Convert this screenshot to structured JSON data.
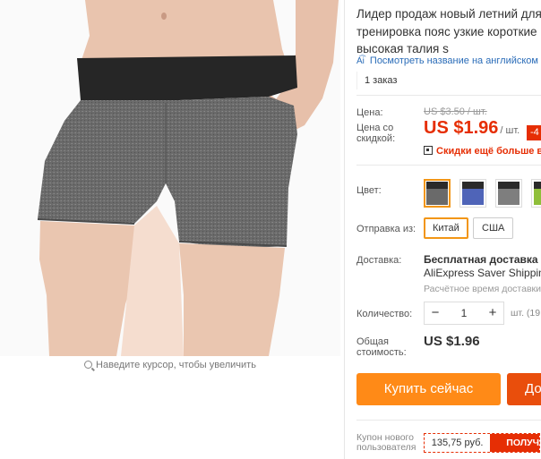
{
  "product_image": {
    "zoom_hint": "Наведите курсор, чтобы увеличить"
  },
  "product": {
    "title_lines": [
      "Лидер продаж новый летний для",
      "тренировка пояс узкие короткие",
      "высокая талия s"
    ],
    "translate_link": "Посмотреть название на английском",
    "translate_icon": "translate-icon",
    "orders": "1 заказ"
  },
  "pricing": {
    "price_label": "Цена:",
    "old_price": "US $3.50 / шт.",
    "discount_price_label_lines": [
      "Цена со",
      "скидкой:"
    ],
    "discount_price": "US $1.96",
    "unit": "/ шт.",
    "discount_badge": "-4",
    "app_discount": "Скидки ещё больше в",
    "accent_color": "#e62e04"
  },
  "options": {
    "color_label": "Цвет:",
    "color_swatches": [
      {
        "name": "grey",
        "selected": true
      },
      {
        "name": "blue",
        "selected": false
      },
      {
        "name": "grey-black",
        "selected": false
      },
      {
        "name": "green",
        "selected": false
      }
    ],
    "ship_from_label": "Отправка из:",
    "ship_from_options": [
      {
        "label": "Китай",
        "selected": true
      },
      {
        "label": "США",
        "selected": false
      }
    ],
    "selected_color": "#f29616"
  },
  "delivery": {
    "label": "Доставка:",
    "title": "Бесплатная доставка в Р",
    "method": "AliExpress Saver Shipping",
    "estimate": "Расчётное время доставки"
  },
  "quantity": {
    "label": "Количество:",
    "value": "1",
    "minus": "−",
    "plus": "+",
    "available": "шт. (19"
  },
  "total": {
    "label_lines": [
      "Общая",
      "стоимость:"
    ],
    "value": "US $1.96"
  },
  "actions": {
    "buy_now": "Купить сейчас",
    "add_to_cart": "До"
  },
  "coupon": {
    "label_lines": [
      "Купон нового",
      "пользователя"
    ],
    "amount": "135,75 руб.",
    "get": "ПОЛУЧ"
  }
}
